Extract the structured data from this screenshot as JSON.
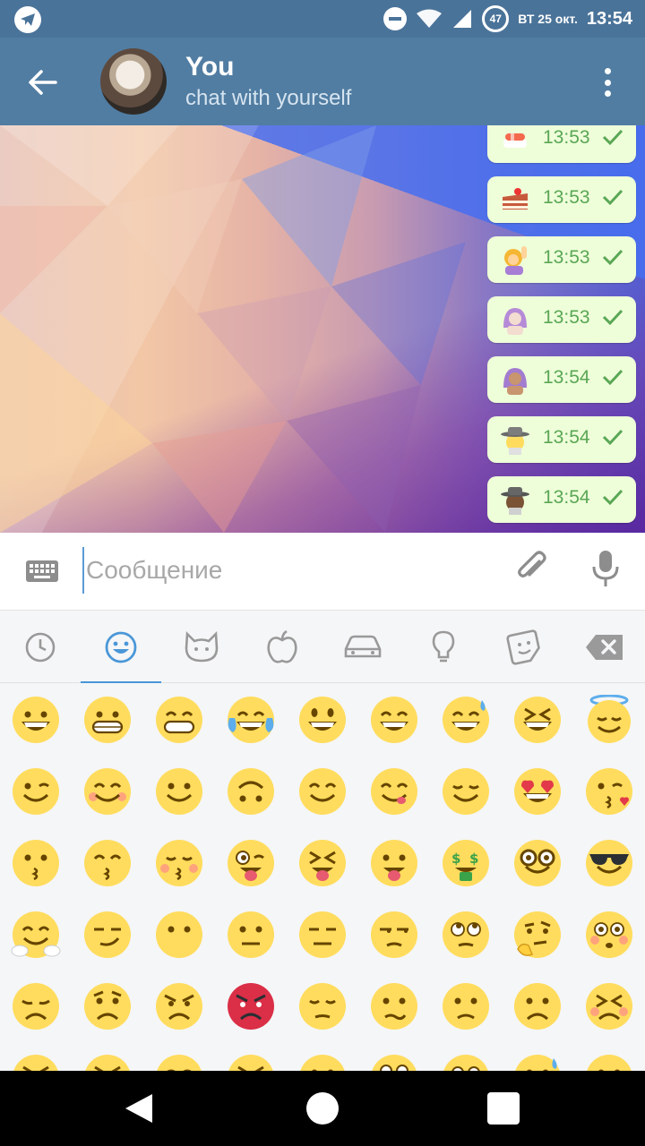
{
  "status_bar": {
    "battery_level": "47",
    "date": "ВТ 25 окт.",
    "time": "13:54"
  },
  "header": {
    "back_icon": "arrow-left-icon",
    "title": "You",
    "subtitle": "chat with yourself",
    "menu_icon": "more-vertical-icon"
  },
  "messages": [
    {
      "sticker": "sushi",
      "time": "13:53",
      "status": "sent-check"
    },
    {
      "sticker": "cake-slice",
      "time": "13:53",
      "status": "sent-check"
    },
    {
      "sticker": "person-raising-hand",
      "time": "13:53",
      "status": "sent-check"
    },
    {
      "sticker": "person-gesturing-ok",
      "time": "13:53",
      "status": "sent-check"
    },
    {
      "sticker": "person-gesturing-ok-medium",
      "time": "13:54",
      "status": "sent-check"
    },
    {
      "sticker": "detective",
      "time": "13:54",
      "status": "sent-check"
    },
    {
      "sticker": "detective-dark",
      "time": "13:54",
      "status": "sent-check"
    }
  ],
  "composer": {
    "placeholder": "Сообщение",
    "value": ""
  },
  "emoji_tabs": [
    {
      "icon": "recent-clock-icon",
      "active": false
    },
    {
      "icon": "smileys-icon",
      "active": true
    },
    {
      "icon": "animals-cat-icon",
      "active": false
    },
    {
      "icon": "food-apple-icon",
      "active": false
    },
    {
      "icon": "travel-car-icon",
      "active": false
    },
    {
      "icon": "objects-bulb-icon",
      "active": false
    },
    {
      "icon": "stickers-icon",
      "active": false
    },
    {
      "icon": "backspace-icon",
      "active": false
    }
  ],
  "emoji_rows": [
    [
      "grinning",
      "grimacing",
      "grin",
      "joy",
      "smiley",
      "smile",
      "sweat-smile",
      "laughing",
      "innocent"
    ],
    [
      "wink",
      "blush",
      "slightly-smiling",
      "upside-down",
      "relaxed",
      "yum",
      "relieved",
      "heart-eyes",
      "kissing-heart"
    ],
    [
      "kissing",
      "kissing-smiling-eyes",
      "kissing-closed-eyes",
      "stuck-out-tongue-winking",
      "stuck-out-tongue-closed-eyes",
      "stuck-out-tongue",
      "money-mouth",
      "nerd",
      "sunglasses"
    ],
    [
      "hugging",
      "smirk",
      "no-mouth",
      "neutral",
      "expressionless",
      "unamused",
      "rolling-eyes",
      "thinking",
      "flushed"
    ],
    [
      "disappointed",
      "worried",
      "angry",
      "rage",
      "pensive",
      "confused",
      "slightly-frowning",
      "frowning",
      "persevere"
    ],
    [
      "confounded",
      "tired",
      "weary",
      "triumph",
      "open-mouth",
      "scream",
      "fearful",
      "cold-sweat",
      "hushed"
    ]
  ],
  "colors": {
    "statusbar": "#4a7399",
    "appbar": "#517da2",
    "bubble": "#eefed9",
    "time_green": "#5aa755",
    "accent": "#4a97d8",
    "emoji_yellow": "#ffdc5d"
  }
}
